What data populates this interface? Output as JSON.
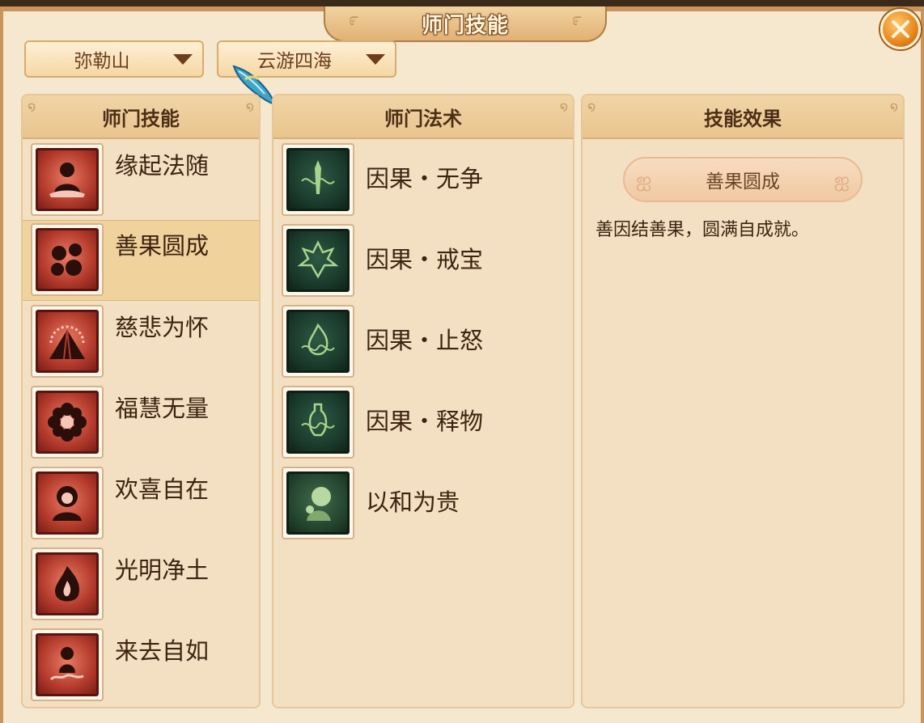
{
  "window": {
    "title": "师门技能"
  },
  "filters": {
    "sect": "弥勒山",
    "category": "云游四海"
  },
  "skills_panel": {
    "header": "师门技能",
    "items": [
      {
        "label": "缘起法随",
        "icon": "sitting-monk-icon"
      },
      {
        "label": "善果圆成",
        "icon": "fruits-icon"
      },
      {
        "label": "慈悲为怀",
        "icon": "radiant-mountain-icon"
      },
      {
        "label": "福慧无量",
        "icon": "lotus-flower-icon"
      },
      {
        "label": "欢喜自在",
        "icon": "laughing-monk-icon"
      },
      {
        "label": "光明净土",
        "icon": "flame-icon"
      },
      {
        "label": "来去自如",
        "icon": "cloud-monk-icon"
      }
    ],
    "selected_index": 1
  },
  "spells_panel": {
    "header": "师门法术",
    "items": [
      {
        "label": "因果・无争",
        "icon": "sword-swirl-icon"
      },
      {
        "label": "因果・戒宝",
        "icon": "demon-swirl-icon"
      },
      {
        "label": "因果・止怒",
        "icon": "flame-swirl-icon"
      },
      {
        "label": "因果・释物",
        "icon": "vase-swirl-icon"
      },
      {
        "label": "以和为贵",
        "icon": "monk-bow-icon"
      }
    ]
  },
  "effect_panel": {
    "header": "技能效果",
    "skill_name": "善果圆成",
    "description": "善因结善果，圆满自成就。"
  },
  "colors": {
    "frame": "#c9935a",
    "panel_bg": "#f3dfc1",
    "selected_row": "#efd29c",
    "text": "#3d2412",
    "close_button": "#e8861c"
  }
}
